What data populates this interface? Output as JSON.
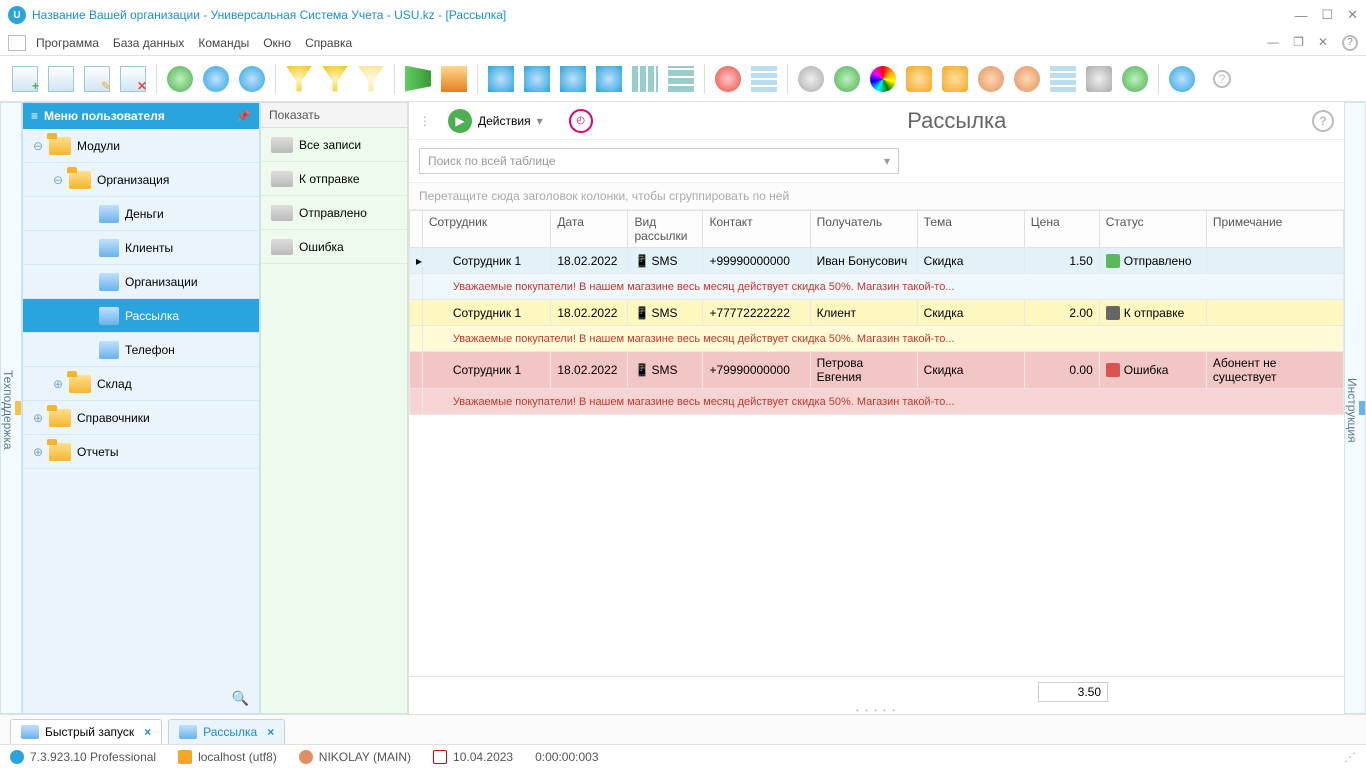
{
  "title": "Название Вашей организации - Универсальная Система Учета - USU.kz - [Рассылка]",
  "menu": {
    "items": [
      "Программа",
      "База данных",
      "Команды",
      "Окно",
      "Справка"
    ]
  },
  "side_left": "Техподдержка",
  "side_right": "Инструкция",
  "nav": {
    "header": "Меню пользователя",
    "items": [
      {
        "label": "Модули",
        "type": "folder",
        "level": 0,
        "expanded": true
      },
      {
        "label": "Организация",
        "type": "folder",
        "level": 1,
        "expanded": true
      },
      {
        "label": "Деньги",
        "type": "file",
        "level": 2
      },
      {
        "label": "Клиенты",
        "type": "file",
        "level": 2
      },
      {
        "label": "Организации",
        "type": "file",
        "level": 2
      },
      {
        "label": "Рассылка",
        "type": "file",
        "level": 2,
        "selected": true
      },
      {
        "label": "Телефон",
        "type": "file",
        "level": 2
      },
      {
        "label": "Склад",
        "type": "folder",
        "level": 1
      },
      {
        "label": "Справочники",
        "type": "folder",
        "level": 0
      },
      {
        "label": "Отчеты",
        "type": "folder",
        "level": 0
      }
    ]
  },
  "filters": {
    "header": "Показать",
    "items": [
      "Все записи",
      "К отправке",
      "Отправлено",
      "Ошибка"
    ]
  },
  "content": {
    "actions_label": "Действия",
    "title": "Рассылка",
    "search_placeholder": "Поиск по всей таблице",
    "grouping_hint": "Перетащите сюда заголовок колонки, чтобы сгруппировать по ней",
    "columns": [
      "Сотрудник",
      "Дата",
      "Вид рассылки",
      "Контакт",
      "Получатель",
      "Тема",
      "Цена",
      "Статус",
      "Примечание"
    ],
    "rows": [
      {
        "employee": "Сотрудник 1",
        "date": "18.02.2022",
        "type": "SMS",
        "contact": "+99990000000",
        "recipient": "Иван Бонусович",
        "subject": "Скидка",
        "price": "1.50",
        "status": "Отправлено",
        "status_k": "sent",
        "note": "",
        "msg": "Уважаемые покупатели! В нашем магазине весь месяц действует скидка 50%. Магазин такой-то..."
      },
      {
        "employee": "Сотрудник 1",
        "date": "18.02.2022",
        "type": "SMS",
        "contact": "+77772222222",
        "recipient": "Клиент",
        "subject": "Скидка",
        "price": "2.00",
        "status": "К отправке",
        "status_k": "pend",
        "note": "",
        "msg": "Уважаемые покупатели! В нашем магазине весь месяц действует скидка 50%. Магазин такой-то..."
      },
      {
        "employee": "Сотрудник 1",
        "date": "18.02.2022",
        "type": "SMS",
        "contact": "+79990000000",
        "recipient": "Петрова Евгения",
        "subject": "Скидка",
        "price": "0.00",
        "status": "Ошибка",
        "status_k": "err",
        "note": "Абонент не существует",
        "msg": "Уважаемые покупатели! В нашем магазине весь месяц действует скидка 50%. Магазин такой-то..."
      }
    ],
    "sum": "3.50"
  },
  "tabs": [
    {
      "label": "Быстрый запуск",
      "active": false
    },
    {
      "label": "Рассылка",
      "active": true
    }
  ],
  "statusbar": {
    "version": "7.3.923.10 Professional",
    "host": "localhost (utf8)",
    "user": "NIKOLAY (MAIN)",
    "date": "10.04.2023",
    "timer": "0:00:00:003"
  }
}
